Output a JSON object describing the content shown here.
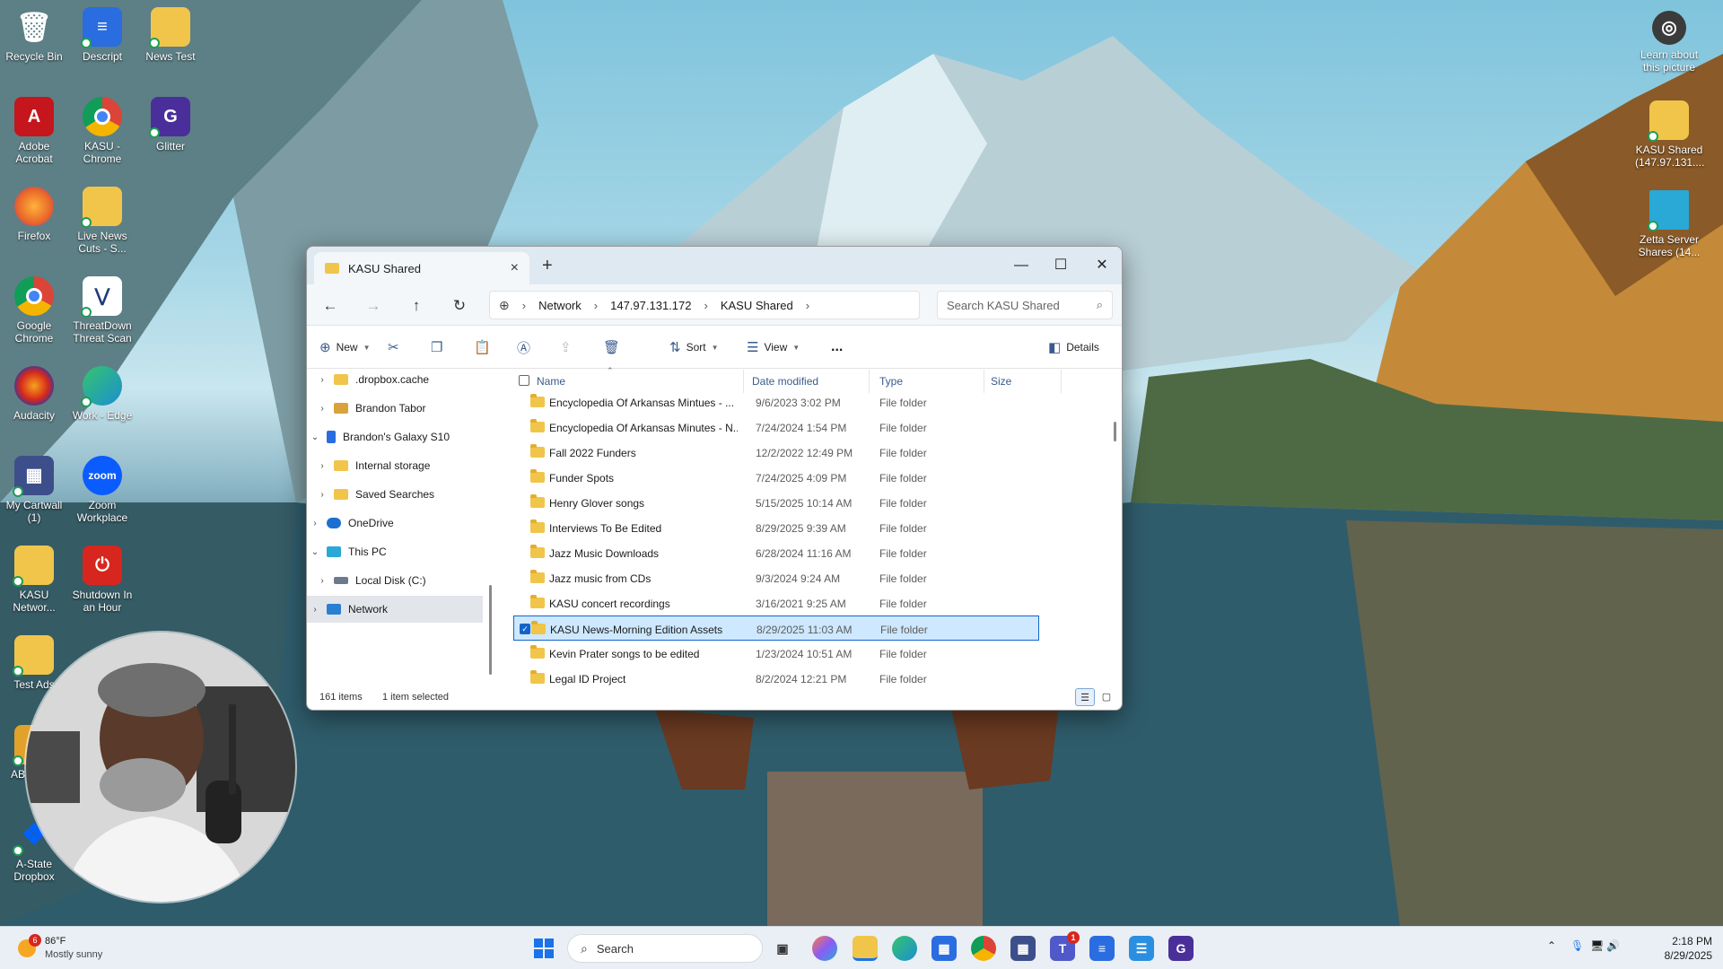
{
  "desktop": {
    "left_icons": [
      {
        "label": "Recycle Bin",
        "icon": "recycle-bin-icon",
        "color": "#4a8fd9"
      },
      {
        "label": "Descript",
        "icon": "descript-icon",
        "color": "#2a6de0"
      },
      {
        "label": "News Test",
        "icon": "folder-icon",
        "color": "#f1c54a"
      },
      {
        "label": "Adobe Acrobat",
        "icon": "acrobat-icon",
        "color": "#c4161c"
      },
      {
        "label": "KASU - Chrome",
        "icon": "chrome-icon",
        "color": "#2f8e4a"
      },
      {
        "label": "Glitter",
        "icon": "glitter-icon",
        "color": "#4a2f9a"
      },
      {
        "label": "Firefox",
        "icon": "firefox-icon",
        "color": "#e8662a"
      },
      {
        "label": "Live News Cuts - S...",
        "icon": "folder-icon",
        "color": "#f1c54a"
      },
      {
        "label": "Google Chrome",
        "icon": "chrome-icon",
        "color": "#2f8e4a"
      },
      {
        "label": "ThreatDown Threat Scan",
        "icon": "threatdown-icon",
        "color": "#1f3b7a"
      },
      {
        "label": "Audacity",
        "icon": "audacity-icon",
        "color": "#2239b0"
      },
      {
        "label": "Work - Edge",
        "icon": "edge-icon",
        "color": "#1b8fd1"
      },
      {
        "label": "My Cartwall (1)",
        "icon": "cartwall-icon",
        "color": "#3d4f8a"
      },
      {
        "label": "Zoom Workplace",
        "icon": "zoom-icon",
        "color": "#0b5cff"
      },
      {
        "label": "KASU Networ...",
        "icon": "folder-icon",
        "color": "#f1c54a"
      },
      {
        "label": "Shutdown In an Hour",
        "icon": "power-icon",
        "color": "#d7261e"
      },
      {
        "label": "Test Ads",
        "icon": "folder-icon",
        "color": "#f1c54a"
      },
      {
        "label": "AB SHUT",
        "icon": "shortcut-icon",
        "color": "#e0a22a"
      },
      {
        "label": "A-State Dropbox",
        "icon": "dropbox-icon",
        "color": "#0061fe"
      }
    ],
    "right_icons": [
      {
        "label": "Learn about this picture",
        "icon": "camera-icon",
        "color": "#3b3b3b"
      },
      {
        "label": "KASU Shared (147.97.131....",
        "icon": "folder-icon",
        "color": "#f1c54a"
      },
      {
        "label": "Zetta Server Shares (14...",
        "icon": "network-drive-icon",
        "color": "#2aa8d6"
      }
    ]
  },
  "explorer": {
    "tab_title": "KASU Shared",
    "breadcrumb": [
      "Network",
      "147.97.131.172",
      "KASU Shared"
    ],
    "search_placeholder": "Search KASU Shared",
    "commands": {
      "new": "New",
      "sort": "Sort",
      "view": "View",
      "more": "...",
      "details": "Details"
    },
    "nav_items": [
      {
        "label": ".dropbox.cache",
        "indent": 1,
        "expanded": false,
        "icon": "folder-icon",
        "color": "#f1c54a"
      },
      {
        "label": "Brandon Tabor",
        "indent": 1,
        "expanded": false,
        "icon": "user-folder-icon",
        "color": "#d9a23a"
      },
      {
        "label": "Brandon's Galaxy S10",
        "indent": 0,
        "expanded": true,
        "icon": "phone-icon",
        "color": "#2a6de0"
      },
      {
        "label": "Internal storage",
        "indent": 1,
        "expanded": false,
        "icon": "folder-icon",
        "color": "#f1c54a"
      },
      {
        "label": "Saved Searches",
        "indent": 1,
        "expanded": false,
        "icon": "folder-icon",
        "color": "#f1c54a"
      },
      {
        "label": "OneDrive",
        "indent": 0,
        "expanded": false,
        "icon": "onedrive-icon",
        "color": "#1b6fd1"
      },
      {
        "label": "This PC",
        "indent": 0,
        "expanded": true,
        "icon": "pc-icon",
        "color": "#2aa8d6"
      },
      {
        "label": "Local Disk (C:)",
        "indent": 1,
        "expanded": false,
        "icon": "disk-icon",
        "color": "#6b7a8c"
      },
      {
        "label": "Network",
        "indent": 0,
        "expanded": false,
        "icon": "network-icon",
        "color": "#2a7fd1",
        "selected": true
      }
    ],
    "columns": [
      "Name",
      "Date modified",
      "Type",
      "Size"
    ],
    "files": [
      {
        "name": "Encyclopedia Of Arkansas Mintues - ...",
        "date": "9/6/2023 3:02 PM",
        "type": "File folder"
      },
      {
        "name": "Encyclopedia Of Arkansas Minutes - N...",
        "date": "7/24/2024 1:54 PM",
        "type": "File folder"
      },
      {
        "name": "Fall 2022 Funders",
        "date": "12/2/2022 12:49 PM",
        "type": "File folder"
      },
      {
        "name": "Funder Spots",
        "date": "7/24/2025 4:09 PM",
        "type": "File folder"
      },
      {
        "name": "Henry Glover songs",
        "date": "5/15/2025 10:14 AM",
        "type": "File folder"
      },
      {
        "name": "Interviews To Be Edited",
        "date": "8/29/2025 9:39 AM",
        "type": "File folder"
      },
      {
        "name": "Jazz Music Downloads",
        "date": "6/28/2024 11:16 AM",
        "type": "File folder"
      },
      {
        "name": "Jazz music from CDs",
        "date": "9/3/2024 9:24 AM",
        "type": "File folder"
      },
      {
        "name": "KASU concert recordings",
        "date": "3/16/2021 9:25 AM",
        "type": "File folder"
      },
      {
        "name": "KASU News-Morning Edition Assets",
        "date": "8/29/2025 11:03 AM",
        "type": "File folder",
        "selected": true
      },
      {
        "name": "Kevin Prater songs to be edited",
        "date": "1/23/2024 10:51 AM",
        "type": "File folder"
      },
      {
        "name": "Legal ID Project",
        "date": "8/2/2024 12:21 PM",
        "type": "File folder"
      }
    ],
    "status": {
      "items": "161 items",
      "selected": "1 item selected"
    }
  },
  "taskbar": {
    "weather": {
      "temp": "86°F",
      "condition": "Mostly sunny",
      "badge": "6"
    },
    "search_label": "Search",
    "apps": [
      {
        "name": "start-button",
        "icon": "windows-icon",
        "color": "#1a73e8"
      },
      {
        "name": "task-view",
        "icon": "task-view-icon",
        "color": "#333333"
      },
      {
        "name": "copilot",
        "icon": "copilot-icon",
        "color": "#8a5cf6"
      },
      {
        "name": "file-explorer",
        "icon": "file-explorer-icon",
        "color": "#f1c54a"
      },
      {
        "name": "edge",
        "icon": "edge-icon",
        "color": "#1b8fd1"
      },
      {
        "name": "store",
        "icon": "store-icon",
        "color": "#2a6de0"
      },
      {
        "name": "chrome",
        "icon": "chrome-icon",
        "color": "#2f8e4a"
      },
      {
        "name": "cartwall",
        "icon": "cartwall-icon",
        "color": "#3d4f8a"
      },
      {
        "name": "teams",
        "icon": "teams-icon",
        "color": "#5059c9",
        "badge": "1"
      },
      {
        "name": "descript",
        "icon": "descript-icon",
        "color": "#2a6de0"
      },
      {
        "name": "notepad",
        "icon": "notepad-icon",
        "color": "#2a8fe0"
      },
      {
        "name": "glitter",
        "icon": "glitter-icon",
        "color": "#4a2f9a"
      }
    ],
    "time": "2:18 PM",
    "date": "8/29/2025"
  }
}
